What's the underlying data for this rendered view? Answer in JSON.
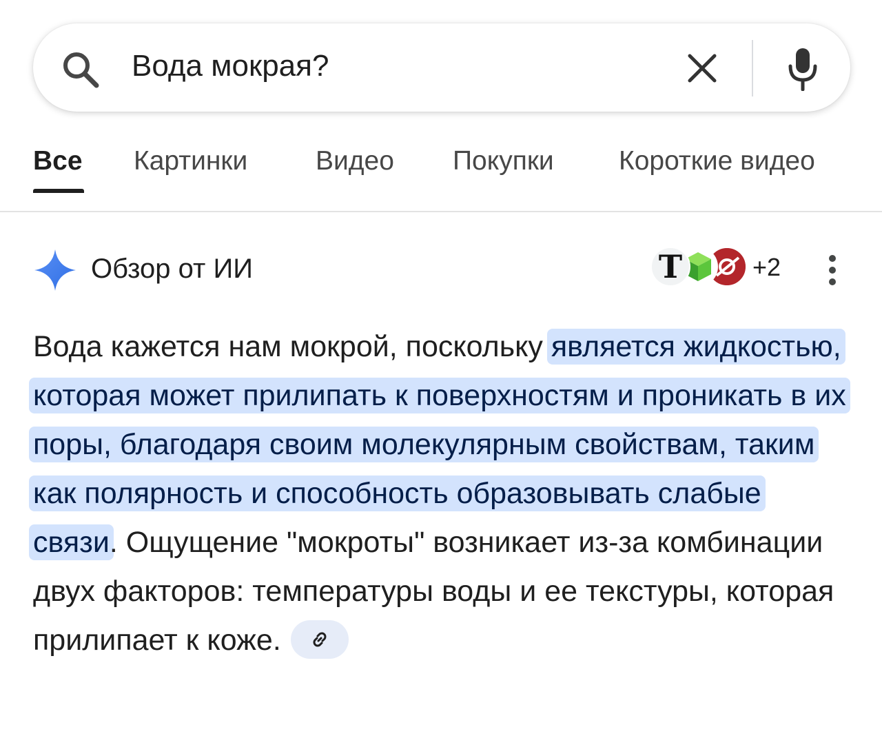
{
  "search": {
    "query": "Вода мокрая?"
  },
  "tabs": [
    {
      "label": "Все",
      "active": true
    },
    {
      "label": "Картинки",
      "active": false
    },
    {
      "label": "Видео",
      "active": false
    },
    {
      "label": "Покупки",
      "active": false
    },
    {
      "label": "Короткие видео",
      "active": false
    }
  ],
  "ai_overview": {
    "title": "Обзор от ИИ",
    "sources": {
      "icons": [
        "t-icon",
        "cube-icon",
        "red-icon"
      ],
      "first_letter": "T",
      "more_count": "+2"
    },
    "answer": {
      "before": "Вода кажется нам мокрой, поскольку ",
      "highlighted": "является жидкостью, которая может прилипать к поверхностям и проникать в их поры, благодаря своим молекулярным свойствам, таким как полярность и способность образовывать слабые связи",
      "after": ". Ощущение \"мокроты\" возникает из-за комбинации двух факторов: температуры воды и ее текстуры, которая прилипает к коже."
    }
  },
  "colors": {
    "highlight_bg": "#d3e3fd",
    "sparkle": "#4285f4",
    "link_chip_bg": "#e6ecf8"
  }
}
